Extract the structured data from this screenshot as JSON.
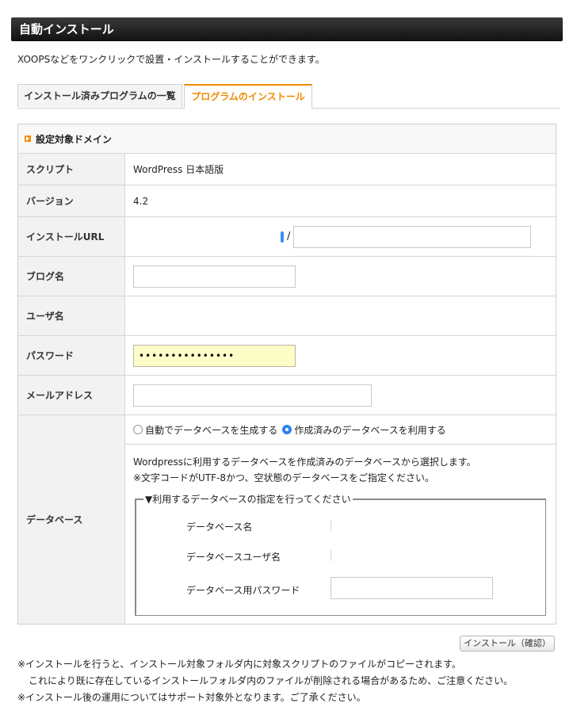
{
  "header": {
    "title": "自動インストール"
  },
  "intro": "XOOPSなどをワンクリックで設置・インストールすることができます。",
  "tabs": [
    {
      "label": "インストール済みプログラムの一覧"
    },
    {
      "label": "プログラムのインストール"
    }
  ],
  "form": {
    "domain_label": "設定対象ドメイン",
    "script": {
      "label": "スクリプト",
      "value": "WordPress 日本語版"
    },
    "version": {
      "label": "バージョン",
      "value": "4.2"
    },
    "install_url": {
      "label": "インストールURL",
      "separator": "/",
      "value": ""
    },
    "blog_name": {
      "label": "ブログ名",
      "value": ""
    },
    "user_name": {
      "label": "ユーザ名",
      "value": ""
    },
    "password": {
      "label": "パスワード",
      "value": "•••••••••••••••"
    },
    "email": {
      "label": "メールアドレス",
      "value": ""
    },
    "database": {
      "label": "データベース",
      "radio_auto": "自動でデータベースを生成する",
      "radio_existing": "作成済みのデータベースを利用する",
      "selected": "existing",
      "desc_line1": "Wordpressに利用するデータベースを作成済みのデータベースから選択します。",
      "desc_line2": "※文字コードがUTF-8かつ、空状態のデータベースをご指定ください。",
      "legend": "▼利用するデータベースの指定を行ってください",
      "db_name_label": "データベース名",
      "db_user_label": "データベースユーザ名",
      "db_password_label": "データベース用パスワード"
    }
  },
  "confirm_button": "インストール（確認）",
  "notes": {
    "line1": "※インストールを行うと、インストール対象フォルダ内に対象スクリプトのファイルがコピーされます。",
    "line2": "これにより既に存在しているインストールフォルダ内のファイルが削除される場合があるため、ご注意ください。",
    "line3": "※インストール後の運用についてはサポート対象外となります。ご了承ください。"
  },
  "colors": {
    "accent": "#f08a00",
    "radio": "#2f7ff0",
    "password_bg": "#fdfdc8"
  }
}
